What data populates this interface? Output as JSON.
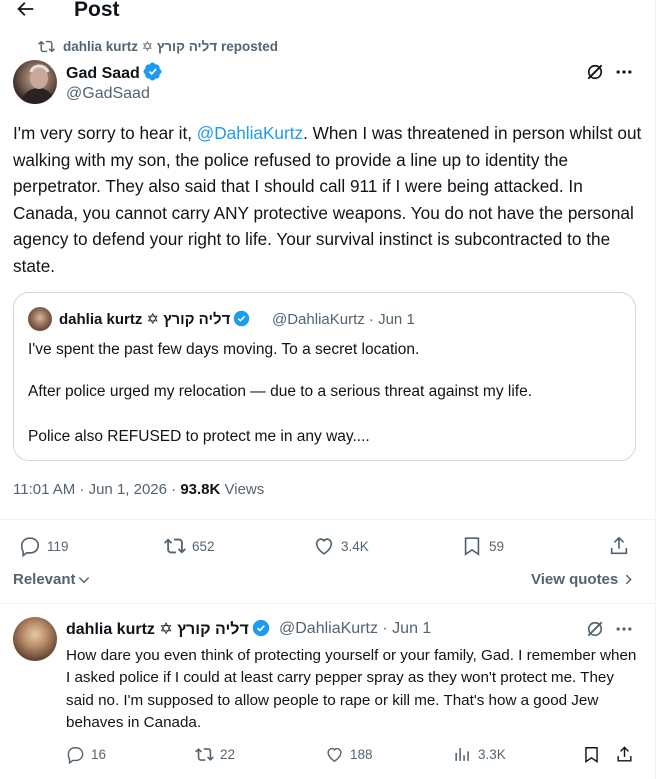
{
  "header": {
    "title": "Post"
  },
  "repost": {
    "text": "dahlia kurtz ✡ דליה קורץ reposted"
  },
  "tweet": {
    "author_name": "Gad Saad",
    "handle": "@GadSaad",
    "text_prefix": "I'm very sorry to hear it, ",
    "mention": "@DahliaKurtz",
    "text_rest": ".  When I was threatened in person whilst out walking with my son, the police refused to provide a line up to identity the perpetrator.  They also said that I should call 911 if I were being attacked.  In Canada, you cannot carry ANY protective weapons.  You do not have the personal agency to defend your right to life.  Your survival instinct is subcontracted to the state.",
    "timestamp": "11:01 AM · Jun 1, 2026 · ",
    "views_count": "93.8K",
    "views_label": " Views",
    "stats": {
      "replies": "119",
      "reposts": "652",
      "likes": "3.4K",
      "bookmarks": "59"
    }
  },
  "quote": {
    "author_name": "dahlia kurtz ✡ דליה קורץ",
    "meta": "@DahliaKurtz · Jun 1",
    "line1": "I've spent the past few days moving. To a secret location.",
    "line2": "After police urged my relocation — due to a serious threat against my life.",
    "line3": "Police also REFUSED to protect me in any way...."
  },
  "sort": {
    "relevant_label": "Relevant",
    "view_quotes_label": "View quotes"
  },
  "reply": {
    "author_name": "dahlia kurtz ✡ דליה קורץ",
    "meta": "@DahliaKurtz · Jun 1",
    "text": "How dare you even think of protecting yourself or your family, Gad. I remember when I asked police if I could at least carry pepper spray as they won't protect me. They said no. I'm supposed to allow people to rape or kill me. That's how a good Jew behaves in Canada.",
    "stats": {
      "replies": "16",
      "reposts": "22",
      "likes": "188",
      "views": "3.3K"
    }
  },
  "colors": {
    "accent": "#1d9bf0",
    "secondary_text": "#536471",
    "border": "#cfd9de"
  },
  "icons": [
    "arrow-left-icon",
    "repost-icon",
    "verified-badge-icon",
    "grok-icon",
    "more-icon",
    "reply-icon",
    "like-icon",
    "bookmark-icon",
    "share-icon",
    "views-icon",
    "chevron-down-icon",
    "chevron-right-icon"
  ]
}
